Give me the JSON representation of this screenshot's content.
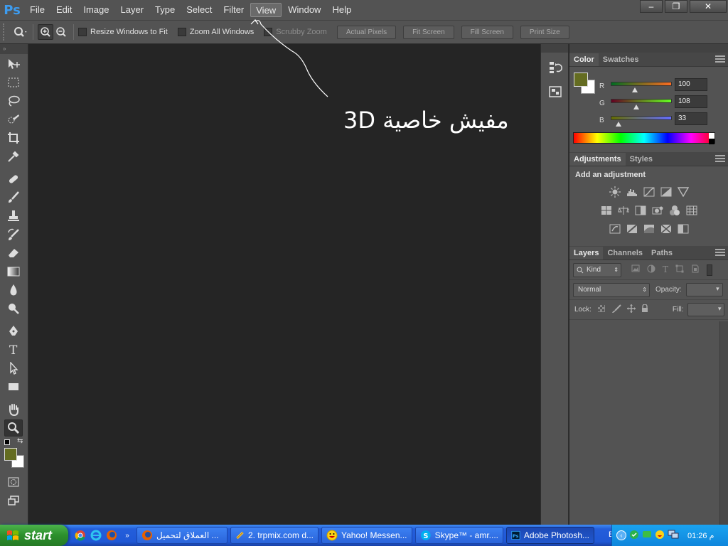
{
  "app": {
    "logo": "Ps",
    "menu": [
      "File",
      "Edit",
      "Image",
      "Layer",
      "Type",
      "Select",
      "Filter",
      "View",
      "Window",
      "Help"
    ],
    "active_menu": "View"
  },
  "window_controls": {
    "minimize": "–",
    "restore": "❐",
    "close": "✕"
  },
  "options": {
    "resize_windows": "Resize Windows to Fit",
    "zoom_all": "Zoom All Windows",
    "scrubby": "Scrubby Zoom",
    "actual_pixels": "Actual Pixels",
    "fit_screen": "Fit Screen",
    "fill_screen": "Fill Screen",
    "print_size": "Print Size"
  },
  "annotation": "مفيش خاصية 3D",
  "color_panel": {
    "tabs": [
      "Color",
      "Swatches"
    ],
    "foreground": "#646c21",
    "background": "#ffffff",
    "channels": [
      {
        "label": "R",
        "value": "100",
        "fraction": 0.39
      },
      {
        "label": "G",
        "value": "108",
        "fraction": 0.42
      },
      {
        "label": "B",
        "value": "33",
        "fraction": 0.13
      }
    ]
  },
  "adjustments_panel": {
    "tabs": [
      "Adjustments",
      "Styles"
    ],
    "title": "Add an adjustment"
  },
  "layers_panel": {
    "tabs": [
      "Layers",
      "Channels",
      "Paths"
    ],
    "kind_label": "Kind",
    "blend_mode": "Normal",
    "opacity_label": "Opacity:",
    "lock_label": "Lock:",
    "fill_label": "Fill:"
  },
  "taskbar": {
    "start": "start",
    "tasks": [
      {
        "label": "العملاق لتحميل ...",
        "icon": "firefox-icon",
        "active": false
      },
      {
        "label": "2. trpmix.com d...",
        "icon": "download-icon",
        "active": false
      },
      {
        "label": "Yahoo! Messen...",
        "icon": "yahoo-messenger-icon",
        "active": false
      },
      {
        "label": "Skype™ - amr....",
        "icon": "skype-icon",
        "active": false
      },
      {
        "label": "Adobe Photosh...",
        "icon": "photoshop-icon",
        "active": true
      }
    ],
    "language": "EN",
    "clock": "01:26 م"
  }
}
